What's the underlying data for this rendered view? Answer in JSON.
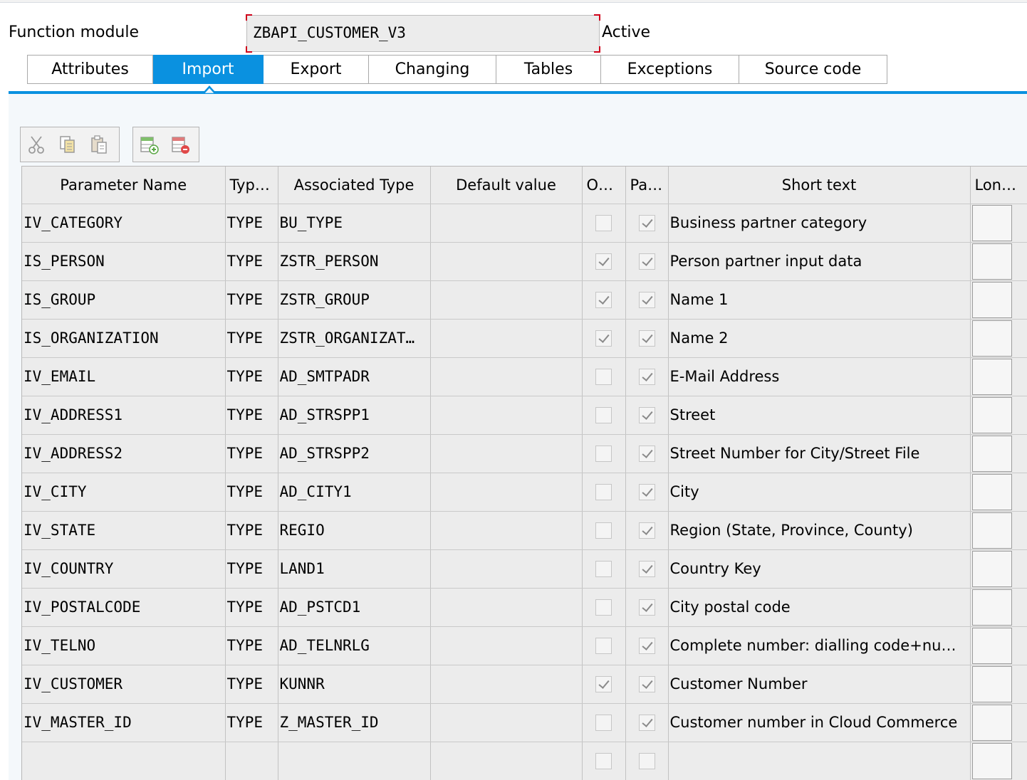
{
  "header": {
    "label": "Function module",
    "name": "ZBAPI_CUSTOMER_V3",
    "status": "Active"
  },
  "tabs": [
    {
      "label": "Attributes",
      "active": false
    },
    {
      "label": "Import",
      "active": true
    },
    {
      "label": "Export",
      "active": false
    },
    {
      "label": "Changing",
      "active": false
    },
    {
      "label": "Tables",
      "active": false
    },
    {
      "label": "Exceptions",
      "active": false
    },
    {
      "label": "Source code",
      "active": false
    }
  ],
  "toolbar": {
    "icons": [
      "cut-icon",
      "copy-icon",
      "paste-icon",
      "insert-row-icon",
      "delete-row-icon"
    ]
  },
  "table": {
    "columns": [
      "Parameter Name",
      "Typi…",
      "Associated Type",
      "Default value",
      "Opt…",
      "Pas…",
      "Short text",
      "Lon…"
    ],
    "rows": [
      {
        "name": "IV_CATEGORY",
        "typing": "TYPE",
        "assoc": "BU_TYPE",
        "default": "",
        "optional": false,
        "pass": true,
        "short": "Business partner category"
      },
      {
        "name": "IS_PERSON",
        "typing": "TYPE",
        "assoc": "ZSTR_PERSON",
        "default": "",
        "optional": true,
        "pass": true,
        "short": "Person partner input data"
      },
      {
        "name": "IS_GROUP",
        "typing": "TYPE",
        "assoc": "ZSTR_GROUP",
        "default": "",
        "optional": true,
        "pass": true,
        "short": "Name 1"
      },
      {
        "name": "IS_ORGANIZATION",
        "typing": "TYPE",
        "assoc": "ZSTR_ORGANIZAT…",
        "default": "",
        "optional": true,
        "pass": true,
        "short": "Name 2"
      },
      {
        "name": "IV_EMAIL",
        "typing": "TYPE",
        "assoc": "AD_SMTPADR",
        "default": "",
        "optional": false,
        "pass": true,
        "short": "E-Mail Address"
      },
      {
        "name": "IV_ADDRESS1",
        "typing": "TYPE",
        "assoc": "AD_STRSPP1",
        "default": "",
        "optional": false,
        "pass": true,
        "short": "Street"
      },
      {
        "name": "IV_ADDRESS2",
        "typing": "TYPE",
        "assoc": "AD_STRSPP2",
        "default": "",
        "optional": false,
        "pass": true,
        "short": "Street Number for City/Street File"
      },
      {
        "name": "IV_CITY",
        "typing": "TYPE",
        "assoc": "AD_CITY1",
        "default": "",
        "optional": false,
        "pass": true,
        "short": "City"
      },
      {
        "name": "IV_STATE",
        "typing": "TYPE",
        "assoc": "REGIO",
        "default": "",
        "optional": false,
        "pass": true,
        "short": "Region (State, Province, County)"
      },
      {
        "name": "IV_COUNTRY",
        "typing": "TYPE",
        "assoc": "LAND1",
        "default": "",
        "optional": false,
        "pass": true,
        "short": "Country Key"
      },
      {
        "name": "IV_POSTALCODE",
        "typing": "TYPE",
        "assoc": "AD_PSTCD1",
        "default": "",
        "optional": false,
        "pass": true,
        "short": "City postal code"
      },
      {
        "name": "IV_TELNO",
        "typing": "TYPE",
        "assoc": "AD_TELNRLG",
        "default": "",
        "optional": false,
        "pass": true,
        "short": "Complete number: dialling code+num…"
      },
      {
        "name": "IV_CUSTOMER",
        "typing": "TYPE",
        "assoc": "KUNNR",
        "default": "",
        "optional": true,
        "pass": true,
        "short": "Customer Number"
      },
      {
        "name": "IV_MASTER_ID",
        "typing": "TYPE",
        "assoc": "Z_MASTER_ID",
        "default": "",
        "optional": false,
        "pass": true,
        "short": "Customer number in Cloud Commerce"
      },
      {
        "name": "",
        "typing": "",
        "assoc": "",
        "default": "",
        "optional": false,
        "pass": false,
        "short": ""
      }
    ]
  },
  "colors": {
    "accent": "#0a91e0",
    "cell_bg": "#ececec",
    "required_marker": "#d0021b"
  }
}
